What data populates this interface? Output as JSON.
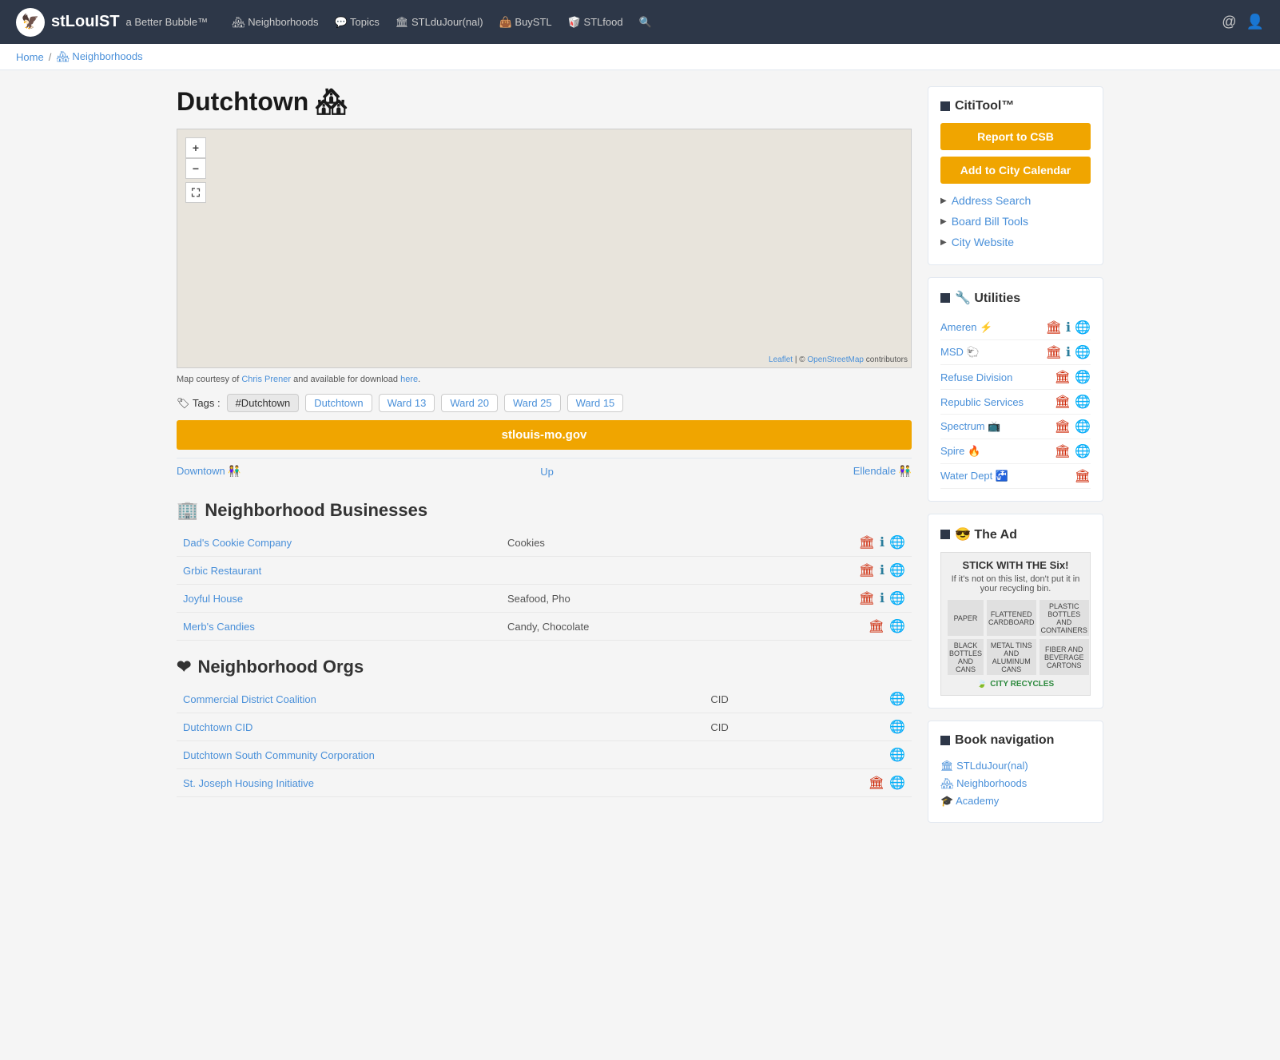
{
  "header": {
    "logo_emoji": "🦅",
    "site_name": "stLouIST",
    "tagline": "a Better Bubble™",
    "nav": [
      {
        "label": "🏘 Neighborhoods",
        "key": "neighborhoods"
      },
      {
        "label": "💬 Topics",
        "key": "topics"
      },
      {
        "label": "🏛 STLduJour(nal)",
        "key": "journal"
      },
      {
        "label": "👜 BuySTL",
        "key": "buy"
      },
      {
        "label": "🥡 STLfood",
        "key": "food"
      }
    ],
    "search_icon": "🔍",
    "email_icon": "@",
    "user_icon": "👤"
  },
  "breadcrumb": {
    "home": "Home",
    "separator": "/",
    "current": "🏘 Neighborhoods"
  },
  "page": {
    "title": "Dutchtown",
    "title_emoji": "🏘",
    "map_credit_text": "Map courtesy of",
    "map_credit_author": "Chris Prener",
    "map_credit_mid": "and available for download",
    "map_credit_link": "here",
    "tags_label": "🏷 Tags :",
    "tags": [
      {
        "label": "#Dutchtown",
        "type": "hashtag"
      },
      {
        "label": "Dutchtown",
        "type": "plain"
      },
      {
        "label": "Ward 13",
        "type": "plain"
      },
      {
        "label": "Ward 20",
        "type": "plain"
      },
      {
        "label": "Ward 25",
        "type": "plain"
      },
      {
        "label": "Ward 15",
        "type": "plain"
      }
    ],
    "website_btn": "stlouis-mo.gov",
    "nav_prev": "Downtown 👫",
    "nav_up": "Up",
    "nav_next": "Ellendale 👫"
  },
  "businesses": {
    "heading_emoji": "🏢",
    "heading": "Neighborhood Businesses",
    "rows": [
      {
        "name": "Dad's Cookie Company",
        "category": "Cookies",
        "has_phone": true,
        "has_info": true,
        "has_web": true
      },
      {
        "name": "Grbic Restaurant",
        "category": "",
        "has_phone": true,
        "has_info": true,
        "has_web": true
      },
      {
        "name": "Joyful House",
        "category": "Seafood, Pho",
        "has_phone": true,
        "has_info": true,
        "has_web": true
      },
      {
        "name": "Merb's Candies",
        "category": "Candy, Chocolate",
        "has_phone": true,
        "has_info": false,
        "has_web": true
      }
    ]
  },
  "orgs": {
    "heading_emoji": "❤",
    "heading": "Neighborhood Orgs",
    "rows": [
      {
        "name": "Commercial District Coalition",
        "type": "CID",
        "has_web": true
      },
      {
        "name": "Dutchtown CID",
        "type": "CID",
        "has_web": true
      },
      {
        "name": "Dutchtown South Community Corporation",
        "type": "",
        "has_web": true
      },
      {
        "name": "St. Joseph Housing Initiative",
        "type": "",
        "has_phone": true,
        "has_web": true
      }
    ]
  },
  "sidebar": {
    "cititool_title": "CitiTool™",
    "report_btn": "Report to CSB",
    "calendar_btn": "Add to City Calendar",
    "address_search": "Address Search",
    "board_bill": "Board Bill Tools",
    "city_website": "City Website",
    "utilities_title": "🔧 Utilities",
    "utilities": [
      {
        "name": "Ameren",
        "emoji": "⚡",
        "has_phone": true,
        "has_info": true,
        "has_web": true
      },
      {
        "name": "MSD",
        "emoji": "🐑",
        "has_phone": true,
        "has_info": true,
        "has_web": true
      },
      {
        "name": "Refuse Division",
        "emoji": "",
        "has_phone": true,
        "has_info": false,
        "has_web": true
      },
      {
        "name": "Republic Services",
        "emoji": "",
        "has_phone": true,
        "has_info": false,
        "has_web": true
      },
      {
        "name": "Spectrum",
        "emoji": "",
        "has_phone": true,
        "has_info": false,
        "has_web": true
      },
      {
        "name": "Spire",
        "emoji": "🔥",
        "has_phone": true,
        "has_info": false,
        "has_web": true
      },
      {
        "name": "Water Dept",
        "emoji": "🚰",
        "has_phone": true,
        "has_info": false,
        "has_web": false
      }
    ],
    "ad_title": "The Ad",
    "ad_title_emoji": "😎",
    "ad_content": "STICK WITH THE Six!",
    "ad_sub": "If it's not on this list, don't put it in your recycling bin.",
    "ad_items": [
      {
        "label": "PAPER"
      },
      {
        "label": "FLATTENED CARDBOARD"
      },
      {
        "label": "PLASTIC BOTTLES AND CONTAINERS"
      },
      {
        "label": "BLACK BOTTLES AND CANS"
      },
      {
        "label": "METAL TINS AND ALUMINUM CANS"
      },
      {
        "label": "FIBER AND BEVERAGE CARTONS"
      }
    ],
    "ad_footer": "CITY RECYCLES",
    "book_nav_title": "Book navigation",
    "book_nav_items": [
      {
        "label": "🏛 STLduJour(nal)"
      },
      {
        "label": "🏘 Neighborhoods"
      },
      {
        "label": "🎓 Academy"
      }
    ]
  }
}
